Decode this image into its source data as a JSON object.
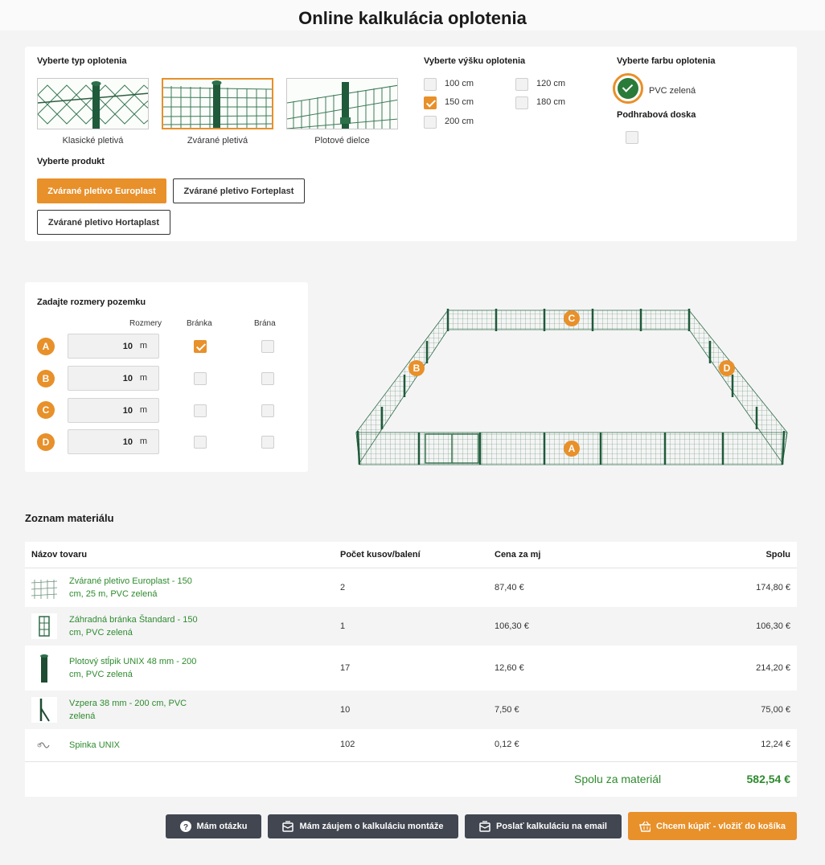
{
  "page_title": "Online kalkulácia oplotenia",
  "fence_type": {
    "label": "Vyberte typ oplotenia",
    "options": [
      {
        "label": "Klasické pletivá",
        "selected": false
      },
      {
        "label": "Zvárané pletivá",
        "selected": true
      },
      {
        "label": "Plotové dielce",
        "selected": false
      }
    ]
  },
  "product": {
    "label": "Vyberte produkt",
    "options": [
      {
        "label": "Zvárané pletivo Europlast",
        "active": true
      },
      {
        "label": "Zvárané pletivo Forteplast",
        "active": false
      },
      {
        "label": "Zvárané pletivo Hortaplast",
        "active": false
      }
    ]
  },
  "height": {
    "label": "Vyberte výšku oplotenia",
    "options": [
      {
        "label": "100 cm",
        "checked": false
      },
      {
        "label": "120 cm",
        "checked": false
      },
      {
        "label": "150 cm",
        "checked": true
      },
      {
        "label": "180 cm",
        "checked": false
      },
      {
        "label": "200 cm",
        "checked": false
      }
    ]
  },
  "color": {
    "label": "Vyberte farbu oplotenia",
    "selected": "PVC zelená",
    "hex": "#2a7a3a"
  },
  "base_board": {
    "label": "Podhrabová doska",
    "checked": false
  },
  "dimensions": {
    "label": "Zadajte rozmery pozemku",
    "col_size": "Rozmery",
    "col_gate_small": "Bránka",
    "col_gate_big": "Brána",
    "rows": [
      {
        "side": "A",
        "value": "10",
        "unit": "m",
        "gate_small": true,
        "gate_big": false
      },
      {
        "side": "B",
        "value": "10",
        "unit": "m",
        "gate_small": false,
        "gate_big": false
      },
      {
        "side": "C",
        "value": "10",
        "unit": "m",
        "gate_small": false,
        "gate_big": false
      },
      {
        "side": "D",
        "value": "10",
        "unit": "m",
        "gate_small": false,
        "gate_big": false
      }
    ]
  },
  "diagram_labels": {
    "a": "A",
    "b": "B",
    "c": "C",
    "d": "D"
  },
  "materials": {
    "title": "Zoznam materiálu",
    "headers": {
      "name": "Názov tovaru",
      "qty": "Počet kusov/balení",
      "price": "Cena za mj",
      "total": "Spolu"
    },
    "items": [
      {
        "name": "Zvárané pletivo Europlast - 150 cm, 25 m, PVC zelená",
        "qty": "2",
        "price": "87,40 €",
        "total": "174,80 €",
        "icon": "mesh-roll-icon"
      },
      {
        "name": "Záhradná bránka Štandard - 150 cm, PVC zelená",
        "qty": "1",
        "price": "106,30 €",
        "total": "106,30 €",
        "icon": "garden-gate-icon"
      },
      {
        "name": "Plotový stĺpik UNIX 48 mm - 200 cm, PVC zelená",
        "qty": "17",
        "price": "12,60 €",
        "total": "214,20 €",
        "icon": "fence-post-icon"
      },
      {
        "name": "Vzpera 38 mm - 200 cm, PVC zelená",
        "qty": "10",
        "price": "7,50 €",
        "total": "75,00 €",
        "icon": "strut-icon"
      },
      {
        "name": "Spinka UNIX",
        "qty": "102",
        "price": "0,12 €",
        "total": "12,24 €",
        "icon": "clip-icon"
      }
    ],
    "total_label": "Spolu za materiál",
    "total_value": "582,54 €"
  },
  "actions": {
    "question": "Mám otázku",
    "installation": "Mám záujem o kalkuláciu montáže",
    "email": "Poslať kalkuláciu na email",
    "buy": "Chcem kúpiť - vložiť do košíka"
  },
  "colors": {
    "accent": "#e8902a",
    "green": "#2e8b2e",
    "dark_button": "#414650"
  }
}
